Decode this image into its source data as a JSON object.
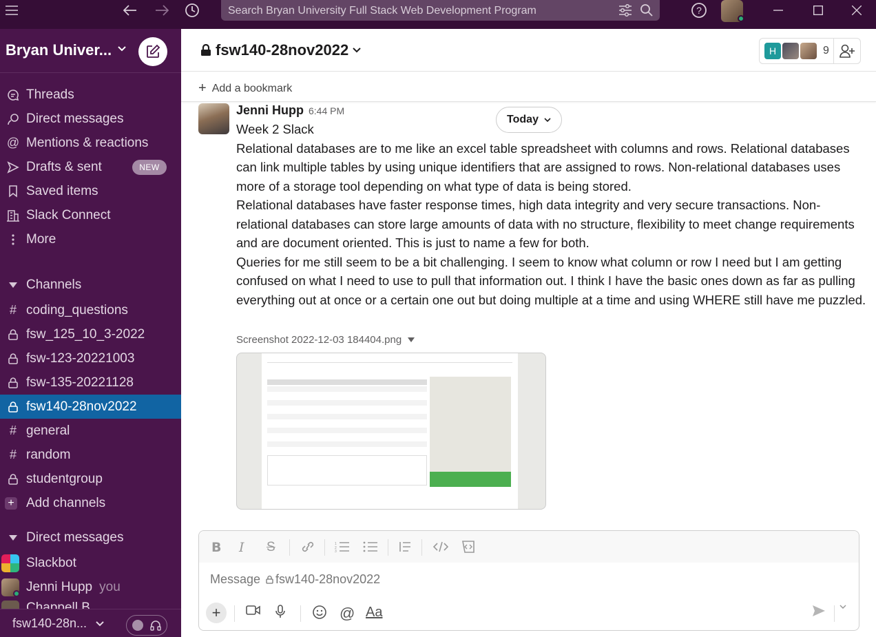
{
  "titlebar": {
    "search_placeholder": "Search Bryan University Full Stack Web Development Program"
  },
  "sidebar": {
    "workspace_name": "Bryan Univer...",
    "nav": [
      {
        "label": "Threads",
        "icon": "threads-icon"
      },
      {
        "label": "Direct messages",
        "icon": "direct-messages-icon"
      },
      {
        "label": "Mentions & reactions",
        "icon": "mention-icon"
      },
      {
        "label": "Drafts & sent",
        "icon": "send-icon",
        "badge": "NEW"
      },
      {
        "label": "Saved items",
        "icon": "bookmark-icon"
      },
      {
        "label": "Slack Connect",
        "icon": "building-icon"
      },
      {
        "label": "More",
        "icon": "more-icon"
      }
    ],
    "channels_header": "Channels",
    "channels": [
      {
        "name": "coding_questions",
        "type": "public"
      },
      {
        "name": "fsw_125_10_3-2022",
        "type": "private"
      },
      {
        "name": "fsw-123-20221003",
        "type": "private"
      },
      {
        "name": "fsw-135-20221128",
        "type": "private"
      },
      {
        "name": "fsw140-28nov2022",
        "type": "private",
        "active": true
      },
      {
        "name": "general",
        "type": "public"
      },
      {
        "name": "random",
        "type": "public"
      },
      {
        "name": "studentgroup",
        "type": "private"
      }
    ],
    "add_channels": "Add channels",
    "dm_header": "Direct messages",
    "dms": [
      {
        "name": "Slackbot",
        "suffix": ""
      },
      {
        "name": "Jenni Hupp",
        "suffix": "you"
      },
      {
        "name": "Chappell B...",
        "suffix": ""
      }
    ],
    "footer_channel": "fsw140-28n..."
  },
  "channel": {
    "name": "fsw140-28nov2022",
    "member_count": "9",
    "member_initial": "H",
    "add_bookmark": "Add a bookmark"
  },
  "message": {
    "author": "Jenni Hupp",
    "time": "6:44 PM",
    "date_divider": "Today",
    "lines": [
      "Week 2 Slack",
      "Relational databases are to me like an excel table spreadsheet with columns and rows.  Relational databases can link multiple tables by using unique identifiers that are assigned to rows.  Non-relational databases uses more of a storage tool depending on what type of data is being stored.",
      "Relational databases have faster response times, high data integrity and very secure transactions.  Non-relational databases can store large amounts of data with no structure, flexibility to meet change requirements and are document oriented.  This is just to name a few for both.",
      "Queries for me still seem to be a bit challenging.  I seem to know what column or row I need but I am getting confused on what I need to use to pull that information out.  I think I have the basic ones down as far as pulling everything out at once or  a certain one out but doing multiple at a time and using WHERE still have me puzzled."
    ],
    "attachment_name": "Screenshot 2022-12-03 184404.png"
  },
  "composer": {
    "placeholder": "Message",
    "channel": "fsw140-28nov2022",
    "format_label": "Aa"
  },
  "colors": {
    "titlebar": "#350d36",
    "sidebar": "#4a154b",
    "active": "#1164a3",
    "presence": "#2bac76"
  }
}
